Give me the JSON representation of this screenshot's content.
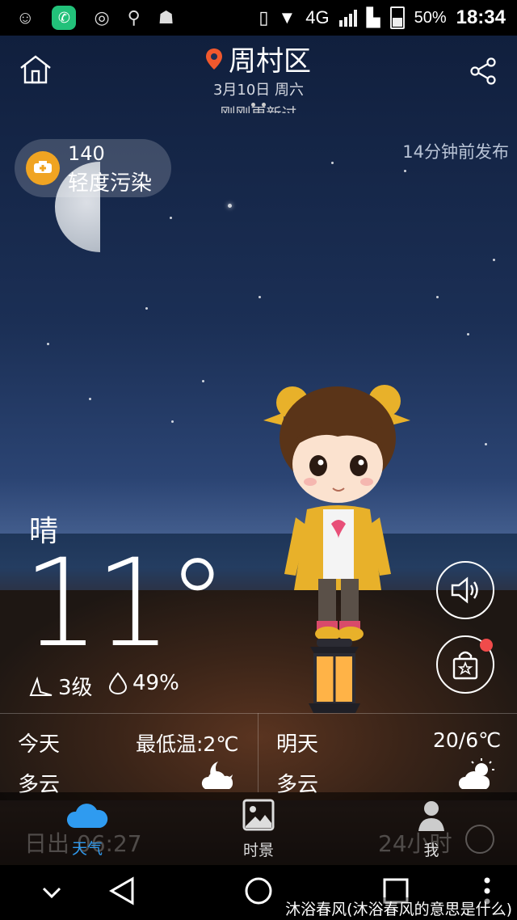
{
  "status_bar": {
    "network": "4G",
    "battery": "50%",
    "time": "18:34"
  },
  "header": {
    "city": "周村区",
    "date": "3月10日 周六",
    "update_status": "刚刚更新过"
  },
  "air_quality": {
    "value": "140",
    "level": "轻度污染"
  },
  "publish_time": "14分钟前发布",
  "current": {
    "condition": "晴",
    "temperature": "11°",
    "wind": "3级",
    "humidity": "49%"
  },
  "forecast": {
    "today": {
      "label": "今天",
      "temp": "最低温:2℃",
      "condition": "多云"
    },
    "tomorrow": {
      "label": "明天",
      "temp": "20/6℃",
      "condition": "多云"
    }
  },
  "sun": {
    "sunrise": "日出 06:27",
    "hours_label": "24小时"
  },
  "tabs": [
    {
      "label": "天气"
    },
    {
      "label": "时景"
    },
    {
      "label": "我"
    }
  ],
  "watermark": "沐浴春风(沐浴春风的意思是什么)",
  "colors": {
    "accent": "#2f9bf0",
    "aqi_badge": "#f0a422",
    "notification_dot": "#f04b4b"
  }
}
